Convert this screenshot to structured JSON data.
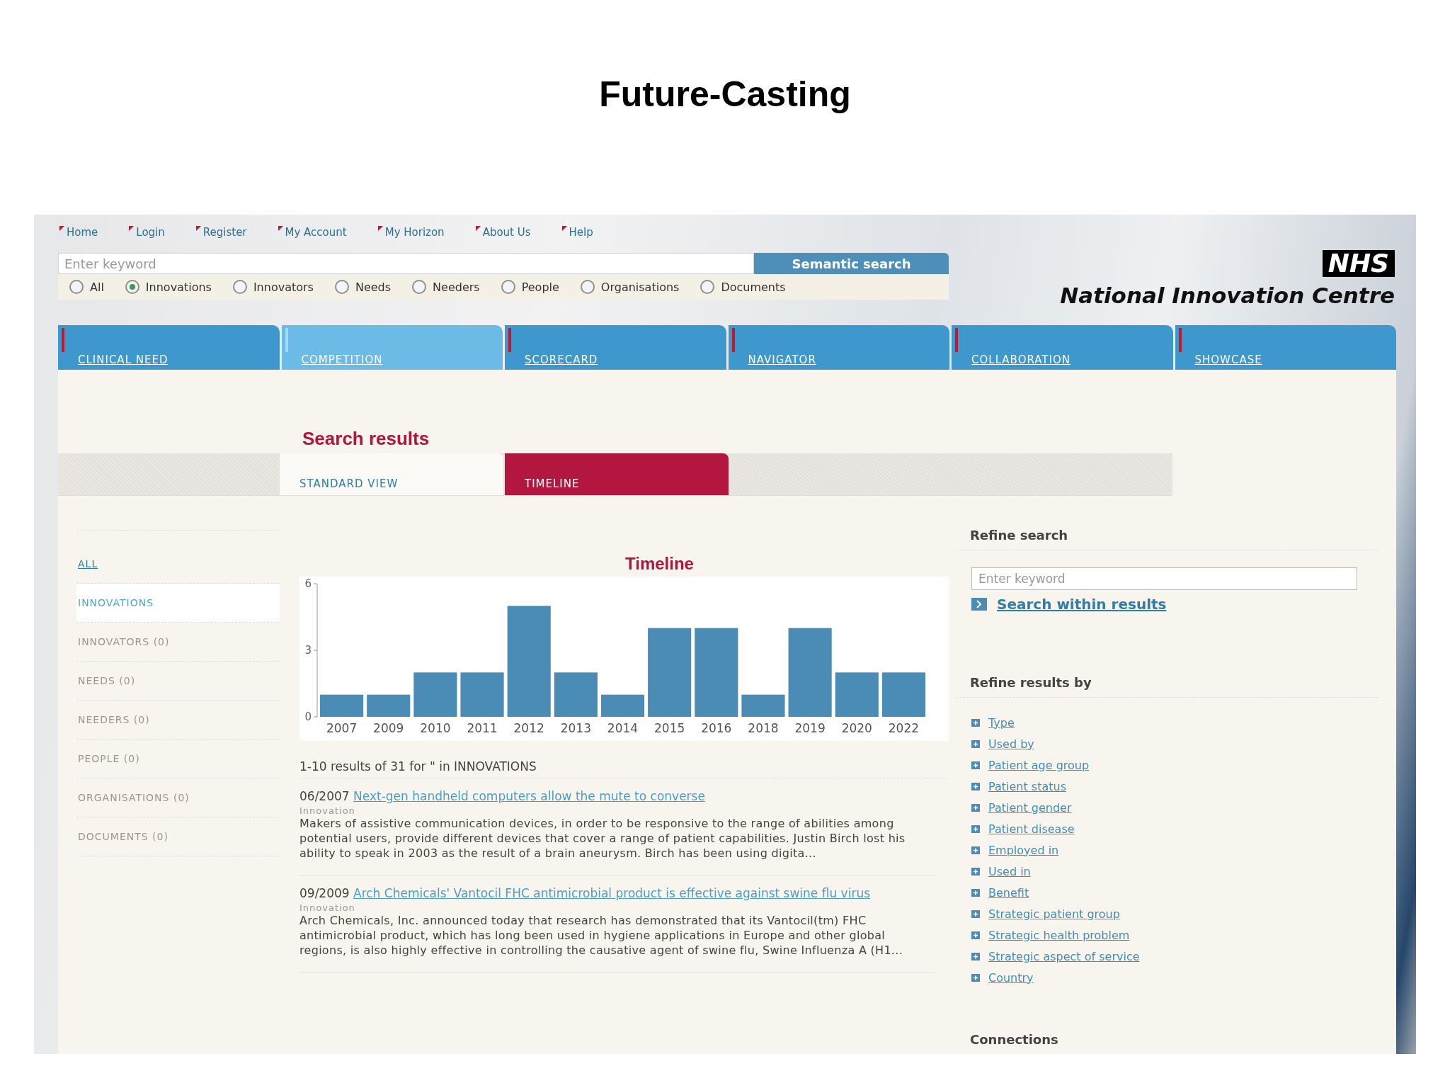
{
  "slide_title": "Future-Casting",
  "top_nav": [
    {
      "label": "Home"
    },
    {
      "label": "Login"
    },
    {
      "label": "Register"
    },
    {
      "label": "My Account"
    },
    {
      "label": "My Horizon"
    },
    {
      "label": "About Us"
    },
    {
      "label": "Help"
    }
  ],
  "search": {
    "placeholder": "Enter keyword",
    "button": "Semantic search"
  },
  "search_scopes": [
    {
      "label": "All",
      "selected": false
    },
    {
      "label": "Innovations",
      "selected": true
    },
    {
      "label": "Innovators",
      "selected": false
    },
    {
      "label": "Needs",
      "selected": false
    },
    {
      "label": "Needers",
      "selected": false
    },
    {
      "label": "People",
      "selected": false
    },
    {
      "label": "Organisations",
      "selected": false
    },
    {
      "label": "Documents",
      "selected": false
    }
  ],
  "logo": {
    "badge": "NHS",
    "name": "National Innovation Centre"
  },
  "main_tabs": [
    {
      "label": "CLINICAL NEED",
      "selected": false
    },
    {
      "label": "COMPETITION",
      "selected": true
    },
    {
      "label": "SCORECARD",
      "selected": false
    },
    {
      "label": "NAVIGATOR",
      "selected": false
    },
    {
      "label": "COLLABORATION",
      "selected": false
    },
    {
      "label": "SHOWCASE",
      "selected": false
    }
  ],
  "results": {
    "heading": "Search results",
    "view_tabs": [
      {
        "label": "STANDARD VIEW",
        "selected": false
      },
      {
        "label": "TIMELINE",
        "selected": true
      }
    ],
    "categories": [
      {
        "label": "ALL",
        "selected": false,
        "disabled": false
      },
      {
        "label": "INNOVATIONS",
        "selected": true,
        "disabled": false
      },
      {
        "label": "INNOVATORS (0)",
        "selected": false,
        "disabled": true
      },
      {
        "label": "NEEDS (0)",
        "selected": false,
        "disabled": true
      },
      {
        "label": "NEEDERS (0)",
        "selected": false,
        "disabled": true
      },
      {
        "label": "PEOPLE (0)",
        "selected": false,
        "disabled": true
      },
      {
        "label": "ORGANISATIONS (0)",
        "selected": false,
        "disabled": true
      },
      {
        "label": "DOCUMENTS (0)",
        "selected": false,
        "disabled": true
      }
    ],
    "timeline": {
      "chart_data": {
        "type": "bar",
        "title": "Timeline",
        "categories": [
          "2007",
          "2009",
          "2010",
          "2011",
          "2012",
          "2013",
          "2014",
          "2015",
          "2016",
          "2018",
          "2019",
          "2020",
          "2022"
        ],
        "values": [
          1,
          1,
          2,
          2,
          5,
          2,
          1,
          4,
          4,
          1,
          4,
          2,
          2
        ],
        "ylim": [
          0,
          6
        ],
        "yticks": [
          0,
          3,
          6
        ]
      }
    },
    "summary": "1-10 results of 31 for \" in INNOVATIONS",
    "items": [
      {
        "date": "06/2007",
        "title": "Next-gen handheld computers allow the mute to converse",
        "type": "Innovation",
        "excerpt": "Makers of assistive communication devices, in order to be responsive to the range of abilities among potential users, provide different devices that cover a range of patient capabilities. Justin Birch lost his ability to speak in 2003 as the result of a brain aneurysm. Birch has been using digita..."
      },
      {
        "date": "09/2009",
        "title": "Arch Chemicals' Vantocil FHC antimicrobial product is effective against swine flu virus",
        "type": "Innovation",
        "excerpt": "Arch Chemicals, Inc. announced today that research has demonstrated that its Vantocil(tm) FHC antimicrobial product, which has long been used in hygiene applications in Europe and other global regions, is also highly effective in controlling the causative agent of swine flu, Swine Influenza A (H1..."
      }
    ]
  },
  "refine": {
    "heading": "Refine search",
    "placeholder": "Enter keyword",
    "button": "Search within results",
    "filters_heading": "Refine results by",
    "filters": [
      {
        "label": "Type"
      },
      {
        "label": "Used by"
      },
      {
        "label": "Patient age group"
      },
      {
        "label": "Patient status"
      },
      {
        "label": "Patient gender"
      },
      {
        "label": "Patient disease"
      },
      {
        "label": "Employed in"
      },
      {
        "label": "Used in"
      },
      {
        "label": "Benefit"
      },
      {
        "label": "Strategic patient group"
      },
      {
        "label": "Strategic health problem"
      },
      {
        "label": "Strategic aspect of service"
      },
      {
        "label": "Country"
      }
    ],
    "connections_heading": "Connections"
  }
}
